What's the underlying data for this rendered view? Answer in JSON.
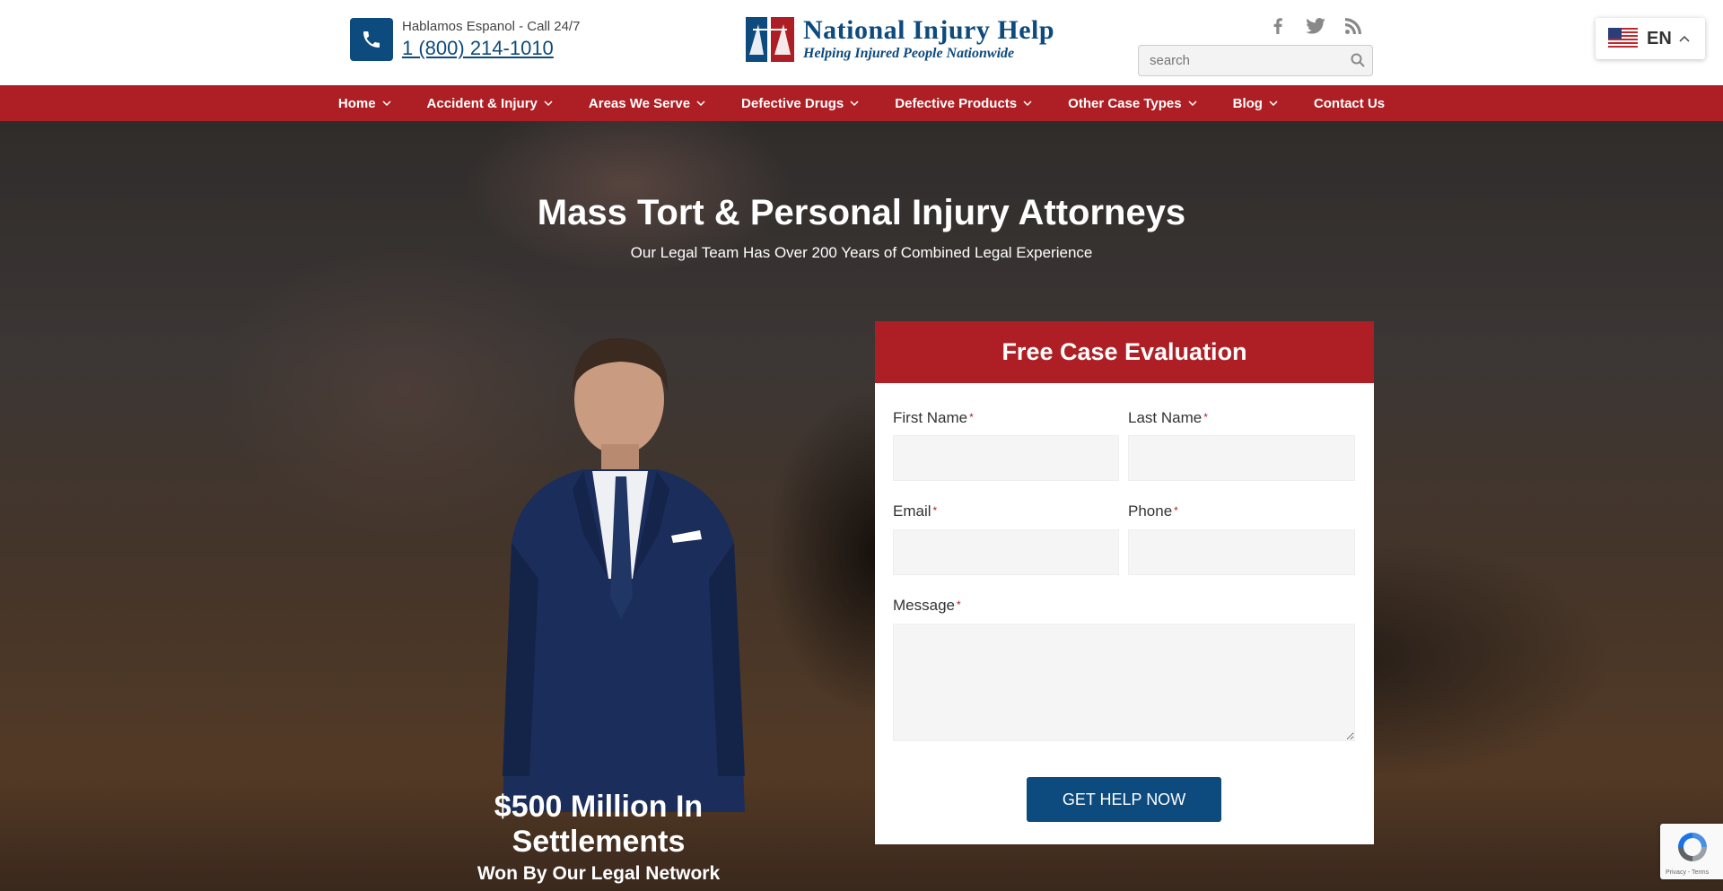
{
  "header": {
    "spanish_text": "Hablamos Espanol - Call 24/7",
    "phone_number": "1 (800) 214-1010",
    "logo_title": "National Injury Help",
    "logo_tagline": "Helping Injured People Nationwide",
    "search_placeholder": "search",
    "social_icons": [
      "facebook-icon",
      "twitter-icon",
      "rss-icon"
    ],
    "language": "EN"
  },
  "nav": {
    "items": [
      {
        "label": "Home",
        "has_dropdown": true
      },
      {
        "label": "Accident & Injury",
        "has_dropdown": true
      },
      {
        "label": "Areas We Serve",
        "has_dropdown": true
      },
      {
        "label": "Defective Drugs",
        "has_dropdown": true
      },
      {
        "label": "Defective Products",
        "has_dropdown": true
      },
      {
        "label": "Other Case Types",
        "has_dropdown": true
      },
      {
        "label": "Blog",
        "has_dropdown": true
      },
      {
        "label": "Contact Us",
        "has_dropdown": false
      }
    ]
  },
  "hero": {
    "title": "Mass Tort & Personal Injury Attorneys",
    "subtitle": "Our Legal Team Has Over 200 Years of Combined Legal Experience",
    "settlements_title": "$500 Million In Settlements",
    "settlements_sub": "Won By Our Legal Network"
  },
  "form": {
    "title": "Free Case Evaluation",
    "first_name_label": "First Name",
    "last_name_label": "Last Name",
    "email_label": "Email",
    "phone_label": "Phone",
    "message_label": "Message",
    "required_mark": "*",
    "first_name_value": "",
    "last_name_value": "",
    "email_value": "",
    "phone_value": "",
    "message_value": "",
    "submit_label": "GET HELP NOW"
  },
  "recaptcha": {
    "footer_text": "Privacy - Terms"
  },
  "colors": {
    "brand_red": "#ad1f24",
    "brand_blue": "#0d4a7d"
  }
}
